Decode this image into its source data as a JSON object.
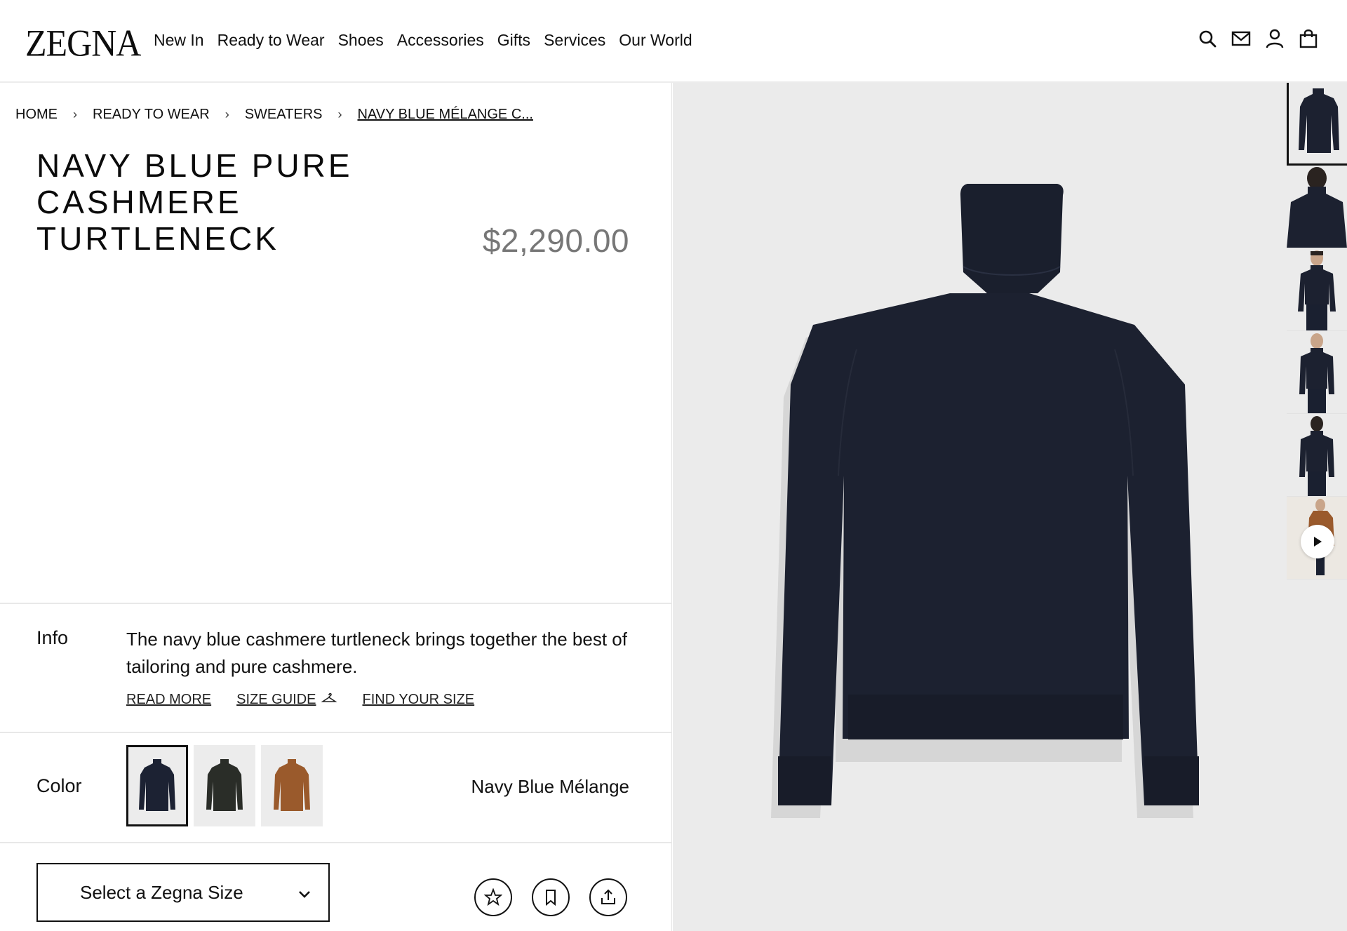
{
  "brand": {
    "logo_text": "ZEGNA"
  },
  "nav": {
    "items": [
      "New In",
      "Ready to Wear",
      "Shoes",
      "Accessories",
      "Gifts",
      "Services",
      "Our World"
    ]
  },
  "header_icons": [
    "search-icon",
    "mail-icon",
    "account-icon",
    "shopping-bag-icon"
  ],
  "breadcrumb": {
    "items": [
      "HOME",
      "READY TO WEAR",
      "SWEATERS",
      "NAVY BLUE MÉLANGE C..."
    ]
  },
  "product": {
    "title": "NAVY BLUE PURE CASHMERE TURTLENECK",
    "price": "$2,290.00"
  },
  "info": {
    "label": "Info",
    "text": "The navy blue  cashmere turtleneck brings together the best of tailoring and pure cashmere.",
    "links": {
      "read_more": "READ MORE",
      "size_guide": "SIZE GUIDE",
      "find_your_size": "FIND YOUR SIZE"
    }
  },
  "color": {
    "label": "Color",
    "selected_name": "Navy Blue Mélange",
    "swatches": [
      {
        "name": "navy",
        "hex": "#1c2233",
        "selected": true
      },
      {
        "name": "dark-green",
        "hex": "#2a2d28",
        "selected": false
      },
      {
        "name": "camel",
        "hex": "#9a5a2c",
        "selected": false
      }
    ]
  },
  "size": {
    "placeholder": "Select a Zegna Size"
  },
  "actions": [
    "favorite-star-icon",
    "bookmark-icon",
    "share-icon"
  ],
  "gallery": {
    "thumbnails": [
      "front",
      "back-model",
      "model-front",
      "model-side",
      "model-back",
      "video"
    ],
    "active_index": 0
  },
  "colors": {
    "garment": "#1c2130",
    "image_bg": "#ebebeb",
    "price": "#777777"
  }
}
